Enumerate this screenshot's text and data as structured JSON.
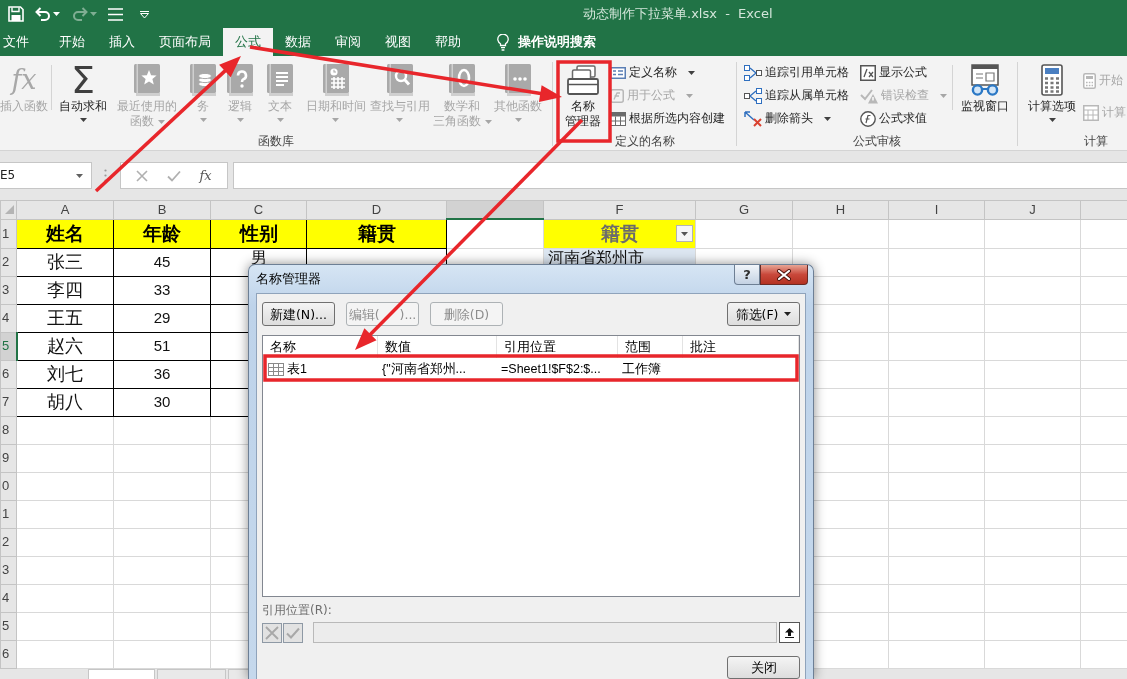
{
  "quick_access": [
    {
      "disabled": false,
      "dropdown": false
    },
    {
      "disabled": false,
      "dropdown": true
    },
    {
      "disabled": true,
      "dropdown": true
    },
    {
      "disabled": false,
      "dropdown": false
    },
    {
      "disabled": false,
      "dropdown": false
    }
  ],
  "window": {
    "title": "动态制作下拉菜单.xlsx  -  Excel"
  },
  "tabs": [
    {
      "label": "文件",
      "selected": false
    },
    {
      "label": "开始",
      "selected": false
    },
    {
      "label": "插入",
      "selected": false
    },
    {
      "label": "页面布局",
      "selected": false
    },
    {
      "label": "公式",
      "selected": true
    },
    {
      "label": "数据",
      "selected": false
    },
    {
      "label": "审阅",
      "selected": false
    },
    {
      "label": "视图",
      "selected": false
    },
    {
      "label": "帮助",
      "selected": false
    }
  ],
  "tell_me": {
    "label": "操作说明搜索"
  },
  "ribbon": {
    "groups": [
      {
        "label": "函数库",
        "items": [
          {
            "kind": "large",
            "glyph": "fx",
            "lines": [
              "插入函数"
            ],
            "disabled": true,
            "dropdown": false,
            "divider_after": true
          },
          {
            "kind": "large",
            "glyph": "Σ",
            "lines": [
              "自动求和"
            ],
            "disabled": false,
            "dropdown": true
          },
          {
            "kind": "large",
            "lines": [
              "最近使用的",
              "函数"
            ],
            "disabled": true,
            "dropdown": true
          },
          {
            "kind": "large",
            "lines": [
              "务"
            ],
            "disabled": true,
            "dropdown": true
          },
          {
            "kind": "large",
            "lines": [
              "逻辑"
            ],
            "disabled": true,
            "dropdown": true
          },
          {
            "kind": "large",
            "lines": [
              "文本"
            ],
            "disabled": true,
            "dropdown": true
          },
          {
            "kind": "large",
            "lines": [
              "日期和时间"
            ],
            "disabled": true,
            "dropdown": true
          },
          {
            "kind": "large",
            "lines": [
              "查找与引用"
            ],
            "disabled": true,
            "dropdown": true
          },
          {
            "kind": "large",
            "lines": [
              "数学和",
              "三角函数"
            ],
            "disabled": true,
            "dropdown": true
          },
          {
            "kind": "large",
            "lines": [
              "其他函数"
            ],
            "disabled": true,
            "dropdown": true
          }
        ]
      },
      {
        "label": "定义的名称",
        "items": [
          {
            "kind": "large",
            "lines": [
              "名称",
              "管理器"
            ],
            "disabled": false,
            "dropdown": false
          },
          {
            "kind": "stack",
            "items": [
              {
                "label": "定义名称",
                "disabled": false,
                "dropdown": true
              },
              {
                "label": "用于公式",
                "disabled": true,
                "dropdown": true
              },
              {
                "label": "根据所选内容创建",
                "disabled": false,
                "dropdown": false
              }
            ]
          }
        ]
      },
      {
        "label": "公式审核",
        "items": [
          {
            "kind": "stack",
            "items": [
              {
                "label": "追踪引用单元格",
                "disabled": false,
                "dropdown": false
              },
              {
                "label": "追踪从属单元格",
                "disabled": false,
                "dropdown": false
              },
              {
                "label": "删除箭头",
                "disabled": false,
                "dropdown": true
              }
            ]
          },
          {
            "kind": "stack",
            "divider_after": true,
            "items": [
              {
                "label": "显示公式",
                "disabled": false,
                "dropdown": false
              },
              {
                "label": "错误检查",
                "disabled": true,
                "dropdown": true
              },
              {
                "label": "公式求值",
                "disabled": false,
                "dropdown": false
              }
            ]
          },
          {
            "kind": "large",
            "lines": [
              "监视窗口"
            ],
            "disabled": false,
            "dropdown": false
          }
        ]
      },
      {
        "label": "计算",
        "items": [
          {
            "kind": "large",
            "lines": [
              "计算选项"
            ],
            "disabled": false,
            "dropdown": true
          },
          {
            "kind": "stack",
            "items": [
              {
                "label": "开始",
                "disabled": true,
                "dropdown": false
              },
              {
                "label": "计算",
                "disabled": true,
                "dropdown": false
              }
            ]
          }
        ]
      }
    ]
  },
  "formula_bar": {
    "name_box": "E5",
    "glyph": "fx"
  },
  "sheet": {
    "columns": [
      {
        "label": "A",
        "selected": false
      },
      {
        "label": "B",
        "selected": false
      },
      {
        "label": "C",
        "selected": false
      },
      {
        "label": "D",
        "selected": false
      },
      {
        "selected": true
      },
      {
        "label": "F",
        "selected": false
      },
      {
        "label": "G",
        "selected": false
      },
      {
        "label": "H",
        "selected": false
      },
      {
        "label": "I",
        "selected": false
      },
      {
        "label": "J",
        "selected": false
      }
    ],
    "rows": [
      {
        "label": "1",
        "selected": false
      },
      {
        "label": "2",
        "selected": false
      },
      {
        "label": "3",
        "selected": false
      },
      {
        "label": "4",
        "selected": false
      },
      {
        "label": "5",
        "selected": true
      },
      {
        "label": "6",
        "selected": false
      },
      {
        "label": "7",
        "selected": false
      },
      {
        "label": "8",
        "selected": false
      },
      {
        "label": "9",
        "selected": false
      },
      {
        "label": "0",
        "selected": false
      },
      {
        "label": "1",
        "selected": false
      },
      {
        "label": "2",
        "selected": false
      },
      {
        "label": "3",
        "selected": false
      },
      {
        "label": "4",
        "selected": false
      },
      {
        "label": "5",
        "selected": false
      },
      {
        "label": "6",
        "selected": false
      }
    ],
    "table": {
      "header": [
        "姓名",
        "年龄",
        "性别",
        "籍贯"
      ],
      "rows": [
        [
          "张三",
          "45",
          "男"
        ],
        [
          "李四",
          "33"
        ],
        [
          "王五",
          "29"
        ],
        [
          "赵六",
          "51"
        ],
        [
          "刘七",
          "36"
        ],
        [
          "胡八",
          "30"
        ]
      ]
    },
    "list_column": {
      "header": "籍贯",
      "filter": true,
      "values": [
        "河南省郑州市"
      ]
    }
  },
  "sheet_tabs": [
    {
      "selected": true
    },
    {
      "selected": false
    },
    {
      "selected": false
    }
  ],
  "dialog": {
    "title": "名称管理器",
    "help_button": {
      "glyph": "?"
    },
    "buttons": [
      {
        "label": [
          "新建(N)..."
        ],
        "disabled": false
      },
      {
        "label": [
          "编辑(",
          ")..."
        ],
        "disabled": true
      },
      {
        "label": [
          "删除(D)"
        ],
        "disabled": true
      }
    ],
    "filter": {
      "label": "筛选(F)"
    },
    "columns": [
      "名称",
      "数值",
      "引用位置",
      "范围",
      "批注"
    ],
    "names": [
      {
        "cells": [
          "表1",
          "{\"河南省郑州...",
          "=Sheet1!$F$2:$...",
          "工作簿"
        ]
      }
    ],
    "reference": {
      "label": "引用位置(R):",
      "disabled": true
    },
    "close": {
      "label": "关闭"
    }
  }
}
